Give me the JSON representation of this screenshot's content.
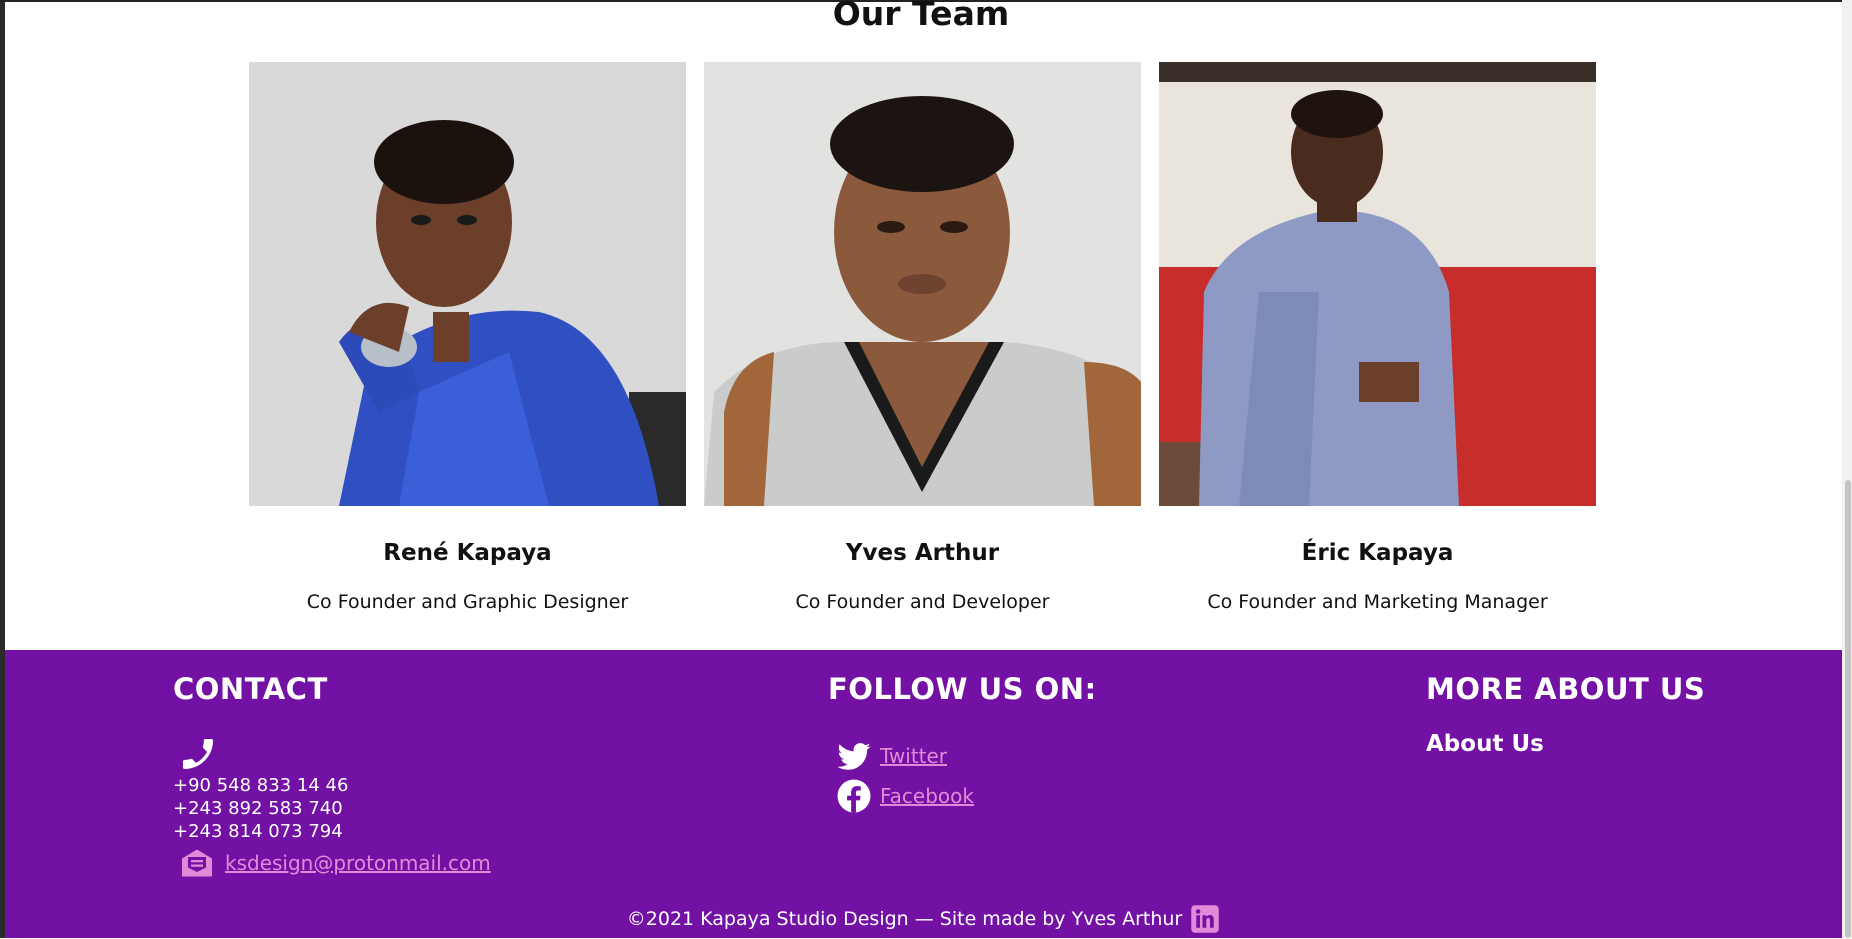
{
  "section": {
    "title": "Our Team"
  },
  "team": [
    {
      "name": "René Kapaya",
      "role": "Co Founder and Graphic Designer"
    },
    {
      "name": "Yves Arthur",
      "role": "Co Founder and Developer"
    },
    {
      "name": "Éric Kapaya",
      "role": "Co Founder and Marketing Manager"
    }
  ],
  "footer": {
    "bg_color": "#7311a4",
    "link_color": "#e28ad8",
    "contact": {
      "title": "CONTACT",
      "phones": [
        "+90 548 833 14 46",
        "+243 892 583 740",
        "+243 814 073 794"
      ],
      "email": "ksdesign@protonmail.com",
      "phone_icon": "phone-icon",
      "mail_icon": "envelope-icon"
    },
    "follow": {
      "title": "FOLLOW US ON:",
      "links": [
        {
          "label": "Twitter",
          "icon": "twitter-icon"
        },
        {
          "label": "Facebook",
          "icon": "facebook-icon"
        }
      ]
    },
    "more": {
      "title": "MORE ABOUT US",
      "about_label": "About Us"
    },
    "copyright": "©2021 Kapaya Studio Design — Site made by Yves Arthur",
    "linkedin_icon": "linkedin-icon"
  }
}
